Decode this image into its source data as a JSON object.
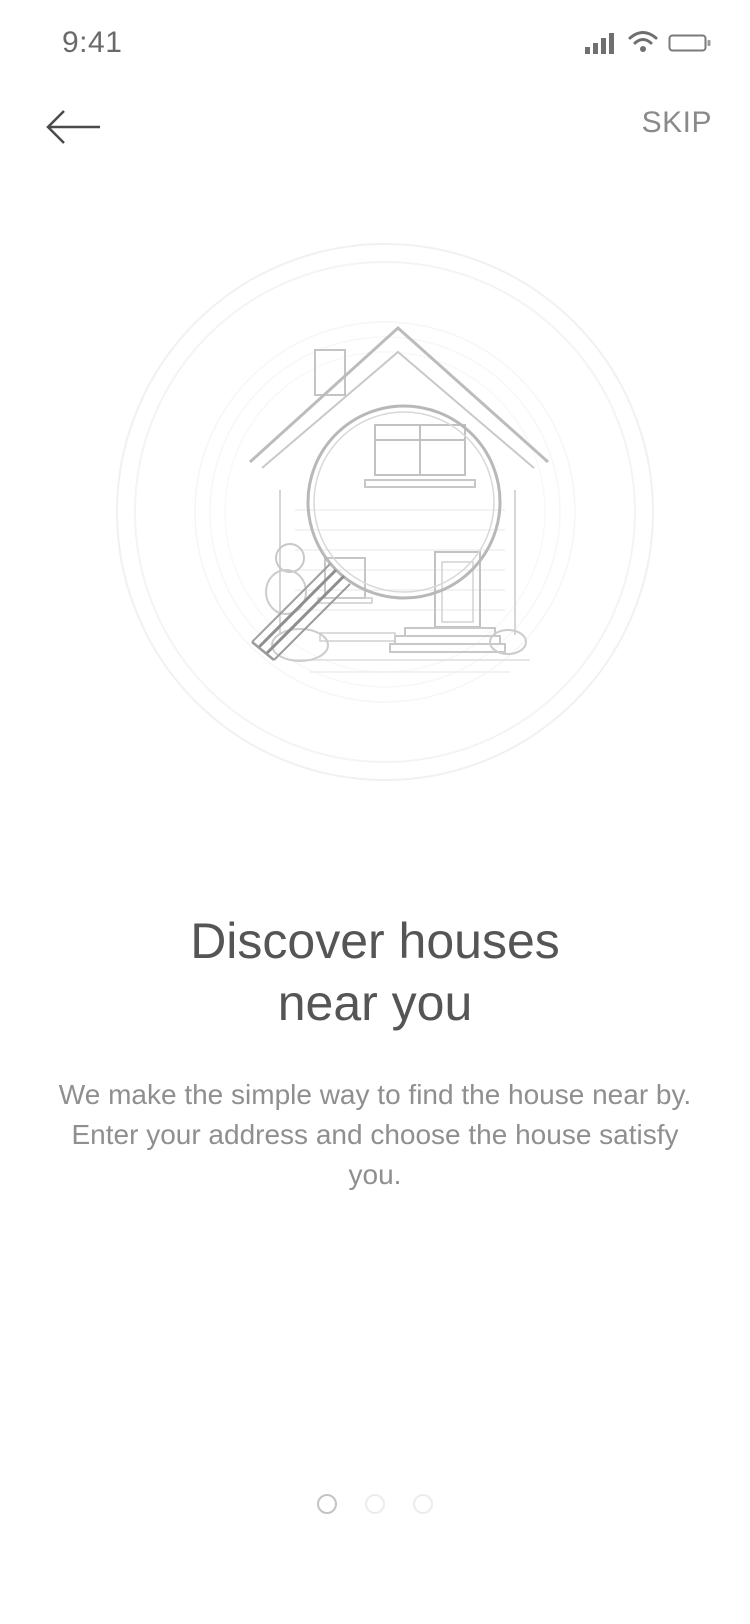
{
  "status_bar": {
    "time": "9:41"
  },
  "nav": {
    "back_icon": "arrow-left-icon",
    "skip_label": "SKIP"
  },
  "onboarding": {
    "illustration": "house-search-icon",
    "title_line1": "Discover houses",
    "title_line2": "near you",
    "description": "We make the simple way to find the house near by. Enter your address and choose the house satisfy you."
  },
  "pagination": {
    "total": 3,
    "active_index": 0
  },
  "colors": {
    "background": "#ffffff",
    "title": "#555555",
    "body_text": "#8f8f8f",
    "line_art": "#bdbdbd"
  }
}
